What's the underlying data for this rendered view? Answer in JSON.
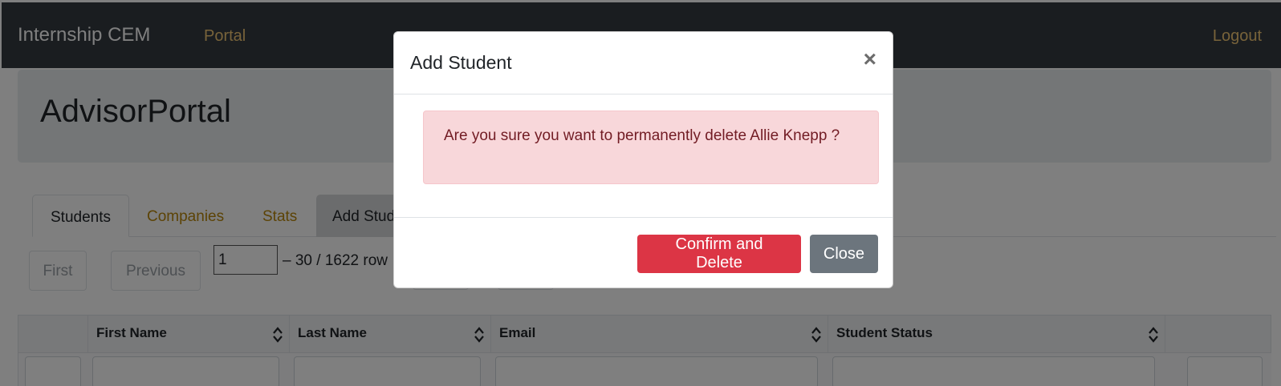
{
  "navbar": {
    "brand": "Internship CEM",
    "portal_link": "Portal",
    "logout_link": "Logout"
  },
  "jumbotron": {
    "title": "AdvisorPortal"
  },
  "tabs": [
    {
      "label": "Students",
      "active": true
    },
    {
      "label": "Companies"
    },
    {
      "label": "Stats"
    },
    {
      "label": "Add Stude"
    }
  ],
  "pagination": {
    "first_label": "First",
    "previous_label": "Previous",
    "page_value": "1",
    "rows_text": "– 30 / 1622 row"
  },
  "table": {
    "columns": [
      "First Name",
      "Last Name",
      "Email",
      "Student Status"
    ]
  },
  "modal": {
    "title": "Add Student",
    "close_glyph": "×",
    "alert_message": "Are you sure you want to permanently delete Allie Knepp ?",
    "confirm_label": "Confirm and Delete",
    "close_label": "Close"
  },
  "colors": {
    "navbar_bg": "#343a40",
    "link_accent": "#f0c674",
    "danger": "#dc3545",
    "secondary": "#6c757d",
    "alert_bg": "#f8d7da"
  }
}
